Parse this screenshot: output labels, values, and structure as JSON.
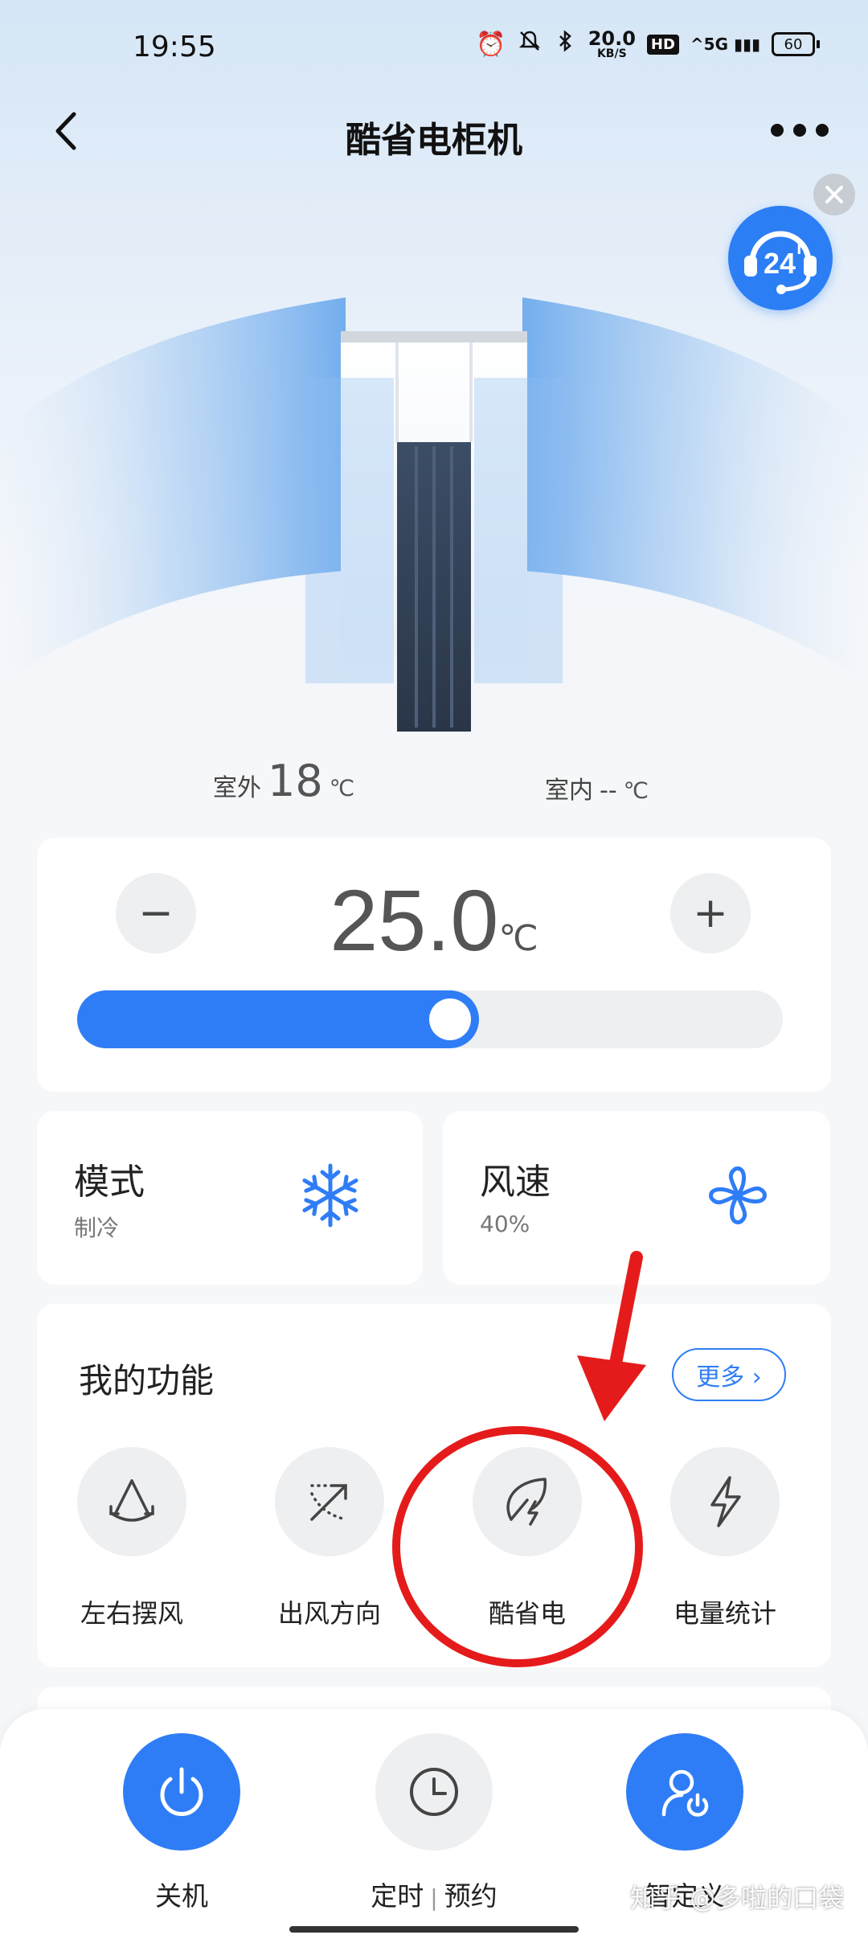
{
  "status_bar": {
    "time": "19:55",
    "net_speed_value": "20.0",
    "net_speed_unit": "KB/S",
    "hd": "HD",
    "signal": "^5G",
    "battery": "60"
  },
  "nav": {
    "title": "酷省电柜机"
  },
  "environment": {
    "outdoor_label": "室外",
    "outdoor_value": "18",
    "outdoor_unit": "℃",
    "indoor_label": "室内",
    "indoor_value": "--",
    "indoor_unit": "℃"
  },
  "temperature": {
    "value": "25.0",
    "unit": "℃",
    "minus": "−",
    "plus": "+",
    "slider_fraction": 0.57
  },
  "mode": {
    "title": "模式",
    "value": "制冷",
    "icon": "snowflake-icon"
  },
  "fan_speed": {
    "title": "风速",
    "value": "40%",
    "icon": "fan-icon"
  },
  "features": {
    "title": "我的功能",
    "more_label": "更多 ›",
    "items": [
      {
        "label": "左右摆风",
        "icon": "swing-icon"
      },
      {
        "label": "出风方向",
        "icon": "airflow-direction-icon"
      },
      {
        "label": "酷省电",
        "icon": "eco-leaf-icon"
      },
      {
        "label": "电量统计",
        "icon": "lightning-icon"
      }
    ]
  },
  "bottom_actions": {
    "power_label": "关机",
    "timer_label": "定时",
    "schedule_label": "预约",
    "custom_label": "智定义"
  },
  "watermark": "知乎 @多啦的口袋",
  "colors": {
    "accent": "#2f7df6",
    "annotation": "#e51b1b"
  }
}
